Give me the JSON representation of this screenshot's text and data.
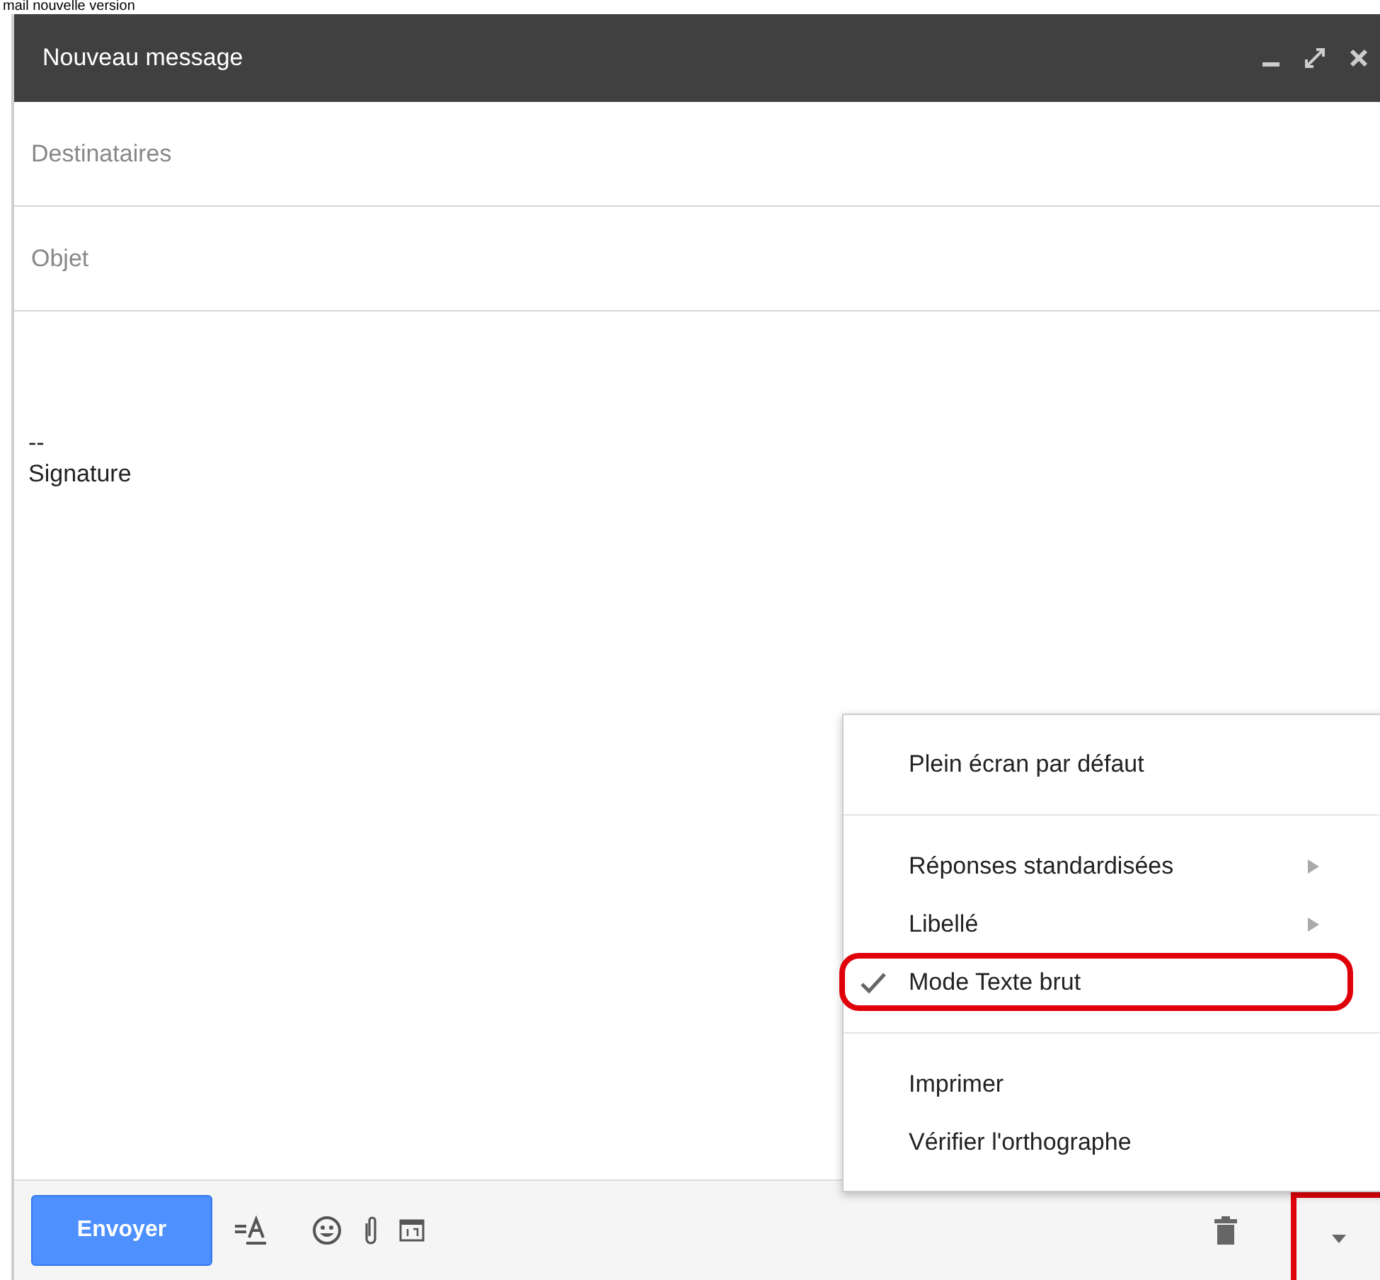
{
  "page_heading": "mail nouvelle version",
  "compose": {
    "title": "Nouveau message",
    "recipients": {
      "placeholder": "Destinataires"
    },
    "subject": {
      "placeholder": "Objet"
    },
    "body": [
      "--",
      "Signature"
    ],
    "send_button": "Envoyer",
    "more_options": {
      "highlighted": true
    }
  },
  "menu": {
    "sections": [
      [
        {
          "label": "Plein écran par défaut",
          "kind": "action",
          "checked": false,
          "highlighted": false
        }
      ],
      [
        {
          "label": "Réponses standardisées",
          "kind": "submenu",
          "checked": false,
          "highlighted": false
        },
        {
          "label": "Libellé",
          "kind": "submenu",
          "checked": false,
          "highlighted": false
        },
        {
          "label": "Mode Texte brut",
          "kind": "action",
          "checked": true,
          "highlighted": true
        }
      ],
      [
        {
          "label": "Imprimer",
          "kind": "action",
          "checked": false,
          "highlighted": false
        },
        {
          "label": "Vérifier l'orthographe",
          "kind": "action",
          "checked": false,
          "highlighted": false
        }
      ]
    ]
  }
}
